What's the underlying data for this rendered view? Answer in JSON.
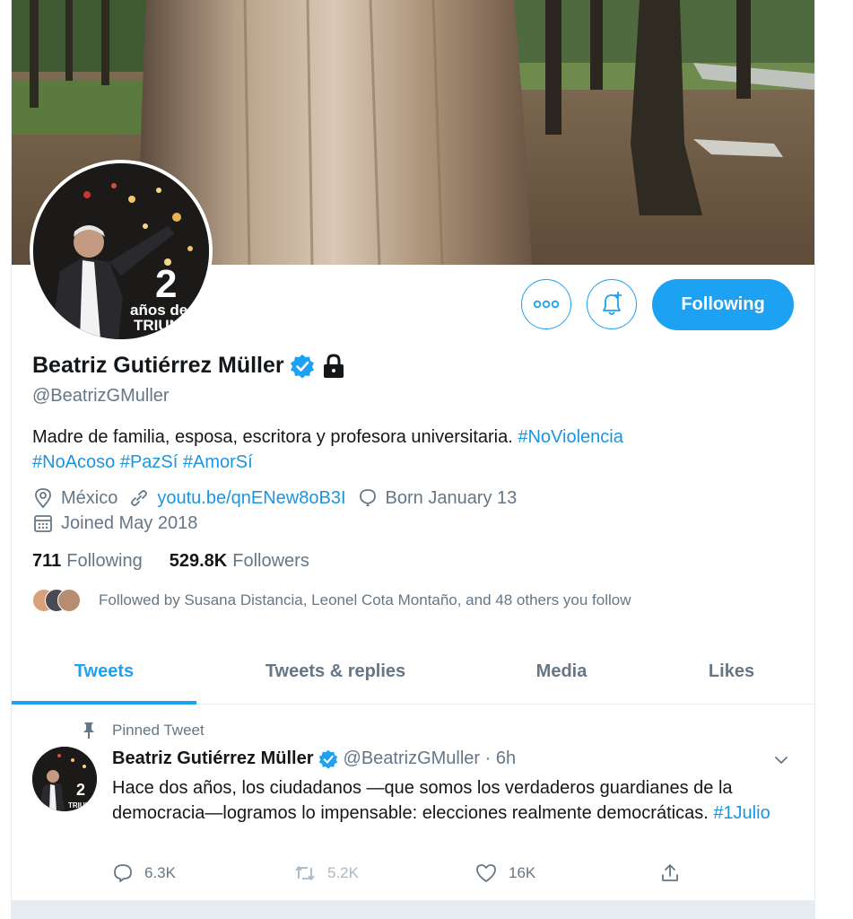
{
  "profile": {
    "name": "Beatriz Gutiérrez Müller",
    "handle": "@BeatrizGMuller",
    "bio_text": "Madre de familia, esposa, escritora y profesora universitaria. ",
    "hashtags": [
      "#NoViolencia",
      "#NoAcoso",
      "#PazSí",
      "#AmorSí"
    ],
    "location": "México",
    "website": "youtu.be/qnENew8oB3I",
    "birthday": "Born January 13",
    "joined": "Joined May 2018",
    "following_count": "711",
    "following_label": "Following",
    "followers_count": "529.8K",
    "followers_label": "Followers",
    "followed_by": "Followed by Susana Distancia, Leonel Cota Montaño, and 48 others you follow",
    "avatar_text_big": "2",
    "avatar_text_small": "años de",
    "avatar_text_small2": "TRIUN"
  },
  "actions": {
    "more_icon": "more-icon",
    "notify_icon": "bell-plus-icon",
    "follow_label": "Following"
  },
  "tabs": [
    "Tweets",
    "Tweets & replies",
    "Media",
    "Likes"
  ],
  "tweet": {
    "pinned_label": "Pinned Tweet",
    "author": "Beatriz Gutiérrez Müller",
    "handle_time": "@BeatrizGMuller · 6h",
    "text": "Hace dos años, los ciudadanos —que somos los verdaderos guardianes de la democracia—logramos lo impensable: elecciones realmente democráticas. ",
    "hashtag": "#1Julio",
    "replies": "6.3K",
    "retweets": "5.2K",
    "likes": "16K"
  },
  "colors": {
    "accent": "#1da1f2",
    "muted": "#657786",
    "text": "#14171a"
  }
}
